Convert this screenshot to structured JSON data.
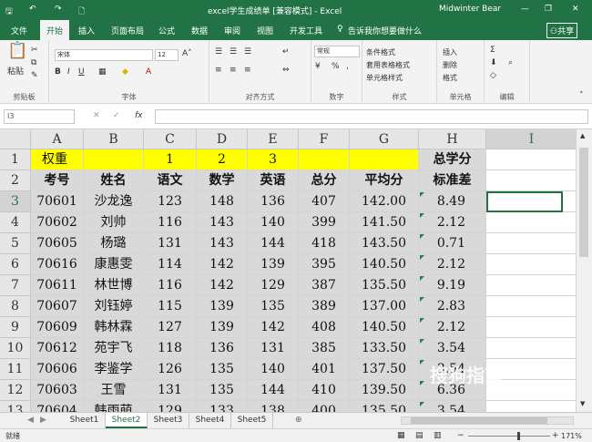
{
  "title": {
    "doc": "excel学生成绩单 [兼容模式] - Excel",
    "user": "Midwinter Bear"
  },
  "tabs": [
    "文件",
    "开始",
    "插入",
    "页面布局",
    "公式",
    "数据",
    "审阅",
    "视图",
    "开发工具"
  ],
  "tell_me": "告诉我你想要做什么",
  "share": "共享",
  "ribbon": {
    "paste": "粘贴",
    "font_name": "宋体",
    "font_size": "12",
    "number_format": "常规",
    "cond_format": "条件格式",
    "table_format": "套用表格格式",
    "cell_style": "单元格样式",
    "insert": "插入",
    "delete": "删除",
    "format": "格式",
    "groups": [
      "剪贴板",
      "字体",
      "对齐方式",
      "数字",
      "样式",
      "单元格",
      "编辑"
    ]
  },
  "namebox": "I3",
  "columns": [
    "A",
    "B",
    "C",
    "D",
    "E",
    "F",
    "G",
    "H",
    "I"
  ],
  "rows": [
    [
      "权重",
      "",
      "1",
      "2",
      "3",
      "",
      "",
      "总学分"
    ],
    [
      "考号",
      "姓名",
      "语文",
      "数学",
      "英语",
      "总分",
      "平均分",
      "标准差"
    ],
    [
      "70601",
      "沙龙逸",
      "123",
      "148",
      "136",
      "407",
      "142.00",
      "8.49"
    ],
    [
      "70602",
      "刘帅",
      "116",
      "143",
      "140",
      "399",
      "141.50",
      "2.12"
    ],
    [
      "70605",
      "杨璐",
      "131",
      "143",
      "144",
      "418",
      "143.50",
      "0.71"
    ],
    [
      "70616",
      "康惠雯",
      "114",
      "142",
      "139",
      "395",
      "140.50",
      "2.12"
    ],
    [
      "70611",
      "林世博",
      "116",
      "142",
      "129",
      "387",
      "135.50",
      "9.19"
    ],
    [
      "70607",
      "刘钰婷",
      "115",
      "139",
      "135",
      "389",
      "137.00",
      "2.83"
    ],
    [
      "70609",
      "韩林霖",
      "127",
      "139",
      "142",
      "408",
      "140.50",
      "2.12"
    ],
    [
      "70612",
      "苑宇飞",
      "118",
      "136",
      "131",
      "385",
      "133.50",
      "3.54"
    ],
    [
      "70606",
      "李鉴学",
      "126",
      "135",
      "140",
      "401",
      "137.50",
      "3.54"
    ],
    [
      "70603",
      "王雪",
      "131",
      "135",
      "144",
      "410",
      "139.50",
      "6.36"
    ],
    [
      "70604",
      "韩雨萌",
      "129",
      "133",
      "138",
      "400",
      "135.50",
      "3.54"
    ]
  ],
  "sheets": [
    "Sheet1",
    "Sheet2",
    "Sheet3",
    "Sheet4",
    "Sheet5"
  ],
  "status": {
    "ready": "就绪",
    "zoom": "171%"
  },
  "watermark": "搜狗指南"
}
